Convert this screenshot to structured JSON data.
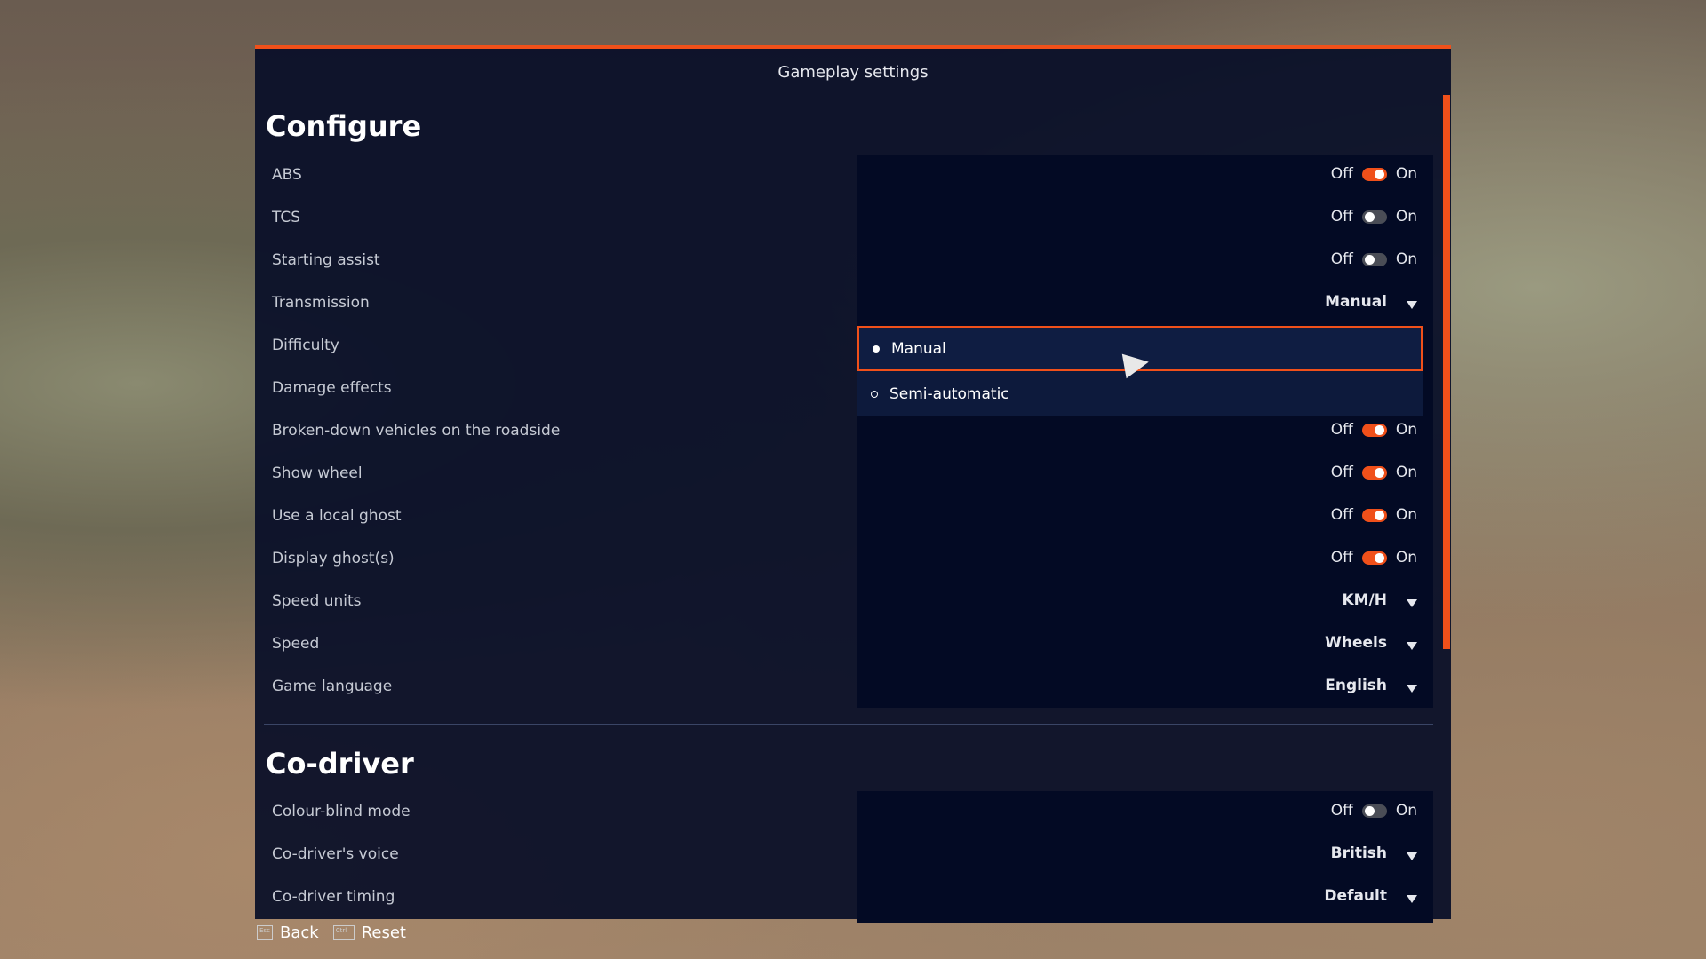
{
  "title": "Gameplay settings",
  "accent": "#f0501a",
  "configure": {
    "heading": "Configure",
    "rows": [
      {
        "label": "ABS",
        "type": "toggle",
        "off": "Off",
        "on": "On",
        "value": true
      },
      {
        "label": "TCS",
        "type": "toggle",
        "off": "Off",
        "on": "On",
        "value": false
      },
      {
        "label": "Starting assist",
        "type": "toggle",
        "off": "Off",
        "on": "On",
        "value": false
      },
      {
        "label": "Transmission",
        "type": "dropdown",
        "value": "Manual"
      },
      {
        "label": "Difficulty",
        "type": "hidden"
      },
      {
        "label": "Damage effects",
        "type": "hidden"
      },
      {
        "label": "Broken-down vehicles on the roadside",
        "type": "toggle",
        "off": "Off",
        "on": "On",
        "value": true
      },
      {
        "label": "Show wheel",
        "type": "toggle",
        "off": "Off",
        "on": "On",
        "value": true
      },
      {
        "label": "Use a local ghost",
        "type": "toggle",
        "off": "Off",
        "on": "On",
        "value": true
      },
      {
        "label": "Display ghost(s)",
        "type": "toggle",
        "off": "Off",
        "on": "On",
        "value": true
      },
      {
        "label": "Speed units",
        "type": "dropdown",
        "value": "KM/H"
      },
      {
        "label": "Speed",
        "type": "dropdown",
        "value": "Wheels"
      },
      {
        "label": "Game language",
        "type": "dropdown",
        "value": "English"
      }
    ]
  },
  "transmission_options": [
    {
      "label": "Manual",
      "selected": true
    },
    {
      "label": "Semi-automatic",
      "selected": false
    }
  ],
  "codriver": {
    "heading": "Co-driver",
    "rows": [
      {
        "label": "Colour-blind mode",
        "type": "toggle",
        "off": "Off",
        "on": "On",
        "value": false
      },
      {
        "label": "Co-driver's voice",
        "type": "dropdown",
        "value": "British"
      },
      {
        "label": "Co-driver timing",
        "type": "dropdown",
        "value": "Default"
      }
    ]
  },
  "footer": {
    "back_key": "Esc",
    "back": "Back",
    "reset_key": "Ctrl",
    "reset": "Reset"
  }
}
